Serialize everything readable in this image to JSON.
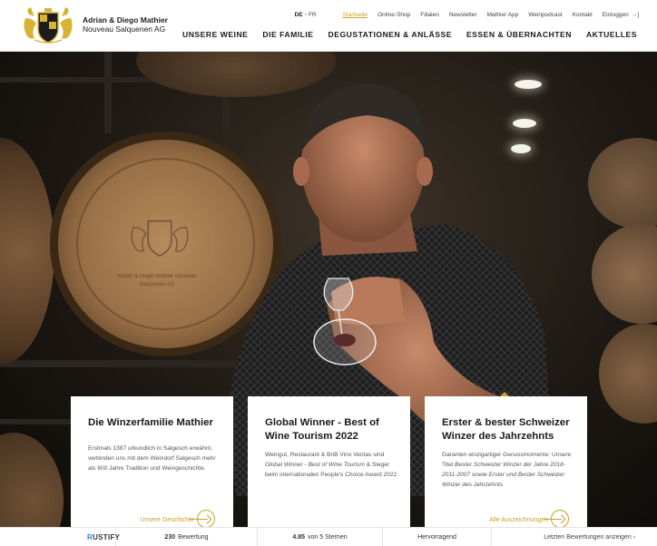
{
  "header": {
    "brand_line1": "Adrian & Diego Mathier",
    "brand_line2": "Nouveau Salquenen AG",
    "logo_icon": "family-crest-logo",
    "lang": {
      "de": "DE",
      "fr": "FR"
    },
    "top_links": [
      {
        "label": "Startseite",
        "active": true
      },
      {
        "label": "Online-Shop"
      },
      {
        "label": "Filialen"
      },
      {
        "label": "Newsletter"
      },
      {
        "label": "Mathier App"
      },
      {
        "label": "Weinpodcast"
      },
      {
        "label": "Kontakt"
      },
      {
        "label": "Einloggen"
      }
    ],
    "main_nav": [
      "UNSERE WEINE",
      "DIE FAMILIE",
      "DEGUSTATIONEN & ANLÄSSE",
      "ESSEN & ÜBERNACHTEN",
      "AKTUELLES"
    ]
  },
  "hero": {
    "barrel_text": "Adrian & Diego Mathier Nouveau Salquenen AG"
  },
  "cards": [
    {
      "title": "Die Winzerfamilie Mathier",
      "text": "Erstmals 1387 urkundlich in Salgesch erwähnt, verbinden uns mit dem Weindorf Salgesch mehr als 600 Jahre Tradition und Weingeschichte.",
      "link": "Unsere Geschichte"
    },
    {
      "title": "Global Winner - Best of Wine Tourism 2022",
      "text_1": "Weingut, Restaurant & BnB Vino Veritas sind ",
      "text_em": "Global Winner - Best of Wine Tourism",
      "text_2": " & Sieger beim internationalen People's Choice Award 2022."
    },
    {
      "title": "Erster & bester Schweizer Winzer des Jahrzehnts",
      "text_1": "Garanten einzigartiger Genussmomente: Unsere Titel ",
      "text_em1": "Bester Schweizer Winzer der Jahre 2018-2011-2007",
      "text_2": " sowie ",
      "text_em2": "Erster und Bester Schweizer Winzer des Jahrzehnts",
      "link": "Alle Auszeichnungen"
    }
  ],
  "bottom_bar": {
    "brand_r": "R",
    "brand_rest": "USTIFY",
    "count": "230",
    "count_label": "Bewertung",
    "stars_value": "4.85",
    "stars_label": "von 5 Sternen",
    "rating_word": "Hervorragend",
    "latest_link": "Letzten Bewertungen anzeigen ›"
  },
  "colors": {
    "accent_gold": "#c9a227",
    "text_dark": "#1a1a1a",
    "rustify_blue": "#2b7de9"
  }
}
